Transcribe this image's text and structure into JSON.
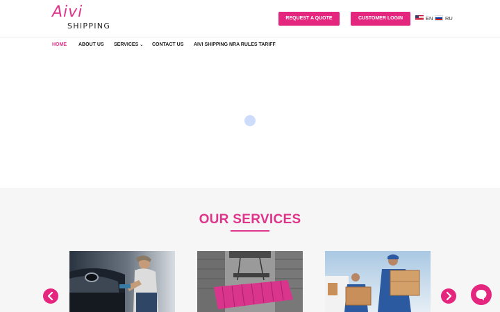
{
  "logo": {
    "brand": "Aivi",
    "tagline": "SHIPPING"
  },
  "header": {
    "quote_label": "REQUEST A QUOTE",
    "login_label": "CUSTOMER LOGIN",
    "languages": [
      {
        "code": "EN",
        "icon": "us-flag-icon"
      },
      {
        "code": "RU",
        "icon": "ru-flag-icon"
      }
    ]
  },
  "nav": {
    "items": [
      {
        "label": "HOME",
        "active": true
      },
      {
        "label": "ABOUT US",
        "active": false
      },
      {
        "label": "SERVICES",
        "active": false,
        "has_dropdown": true
      },
      {
        "label": "CONTACT US",
        "active": false
      },
      {
        "label": "AIVI SHIPPING NRA RULES TARIFF",
        "active": false
      }
    ]
  },
  "services": {
    "title": "OUR SERVICES",
    "cards": [
      {
        "image": "car-shipping-image"
      },
      {
        "image": "container-shipping-image"
      },
      {
        "image": "moving-boxes-image"
      }
    ],
    "prev_icon": "chevron-left-icon",
    "next_icon": "chevron-right-icon"
  },
  "colors": {
    "accent": "#e5267f",
    "loader": "#cddcfa",
    "section_bg": "#f6f6f6"
  },
  "chat": {
    "icon": "chat-bubble-icon"
  }
}
